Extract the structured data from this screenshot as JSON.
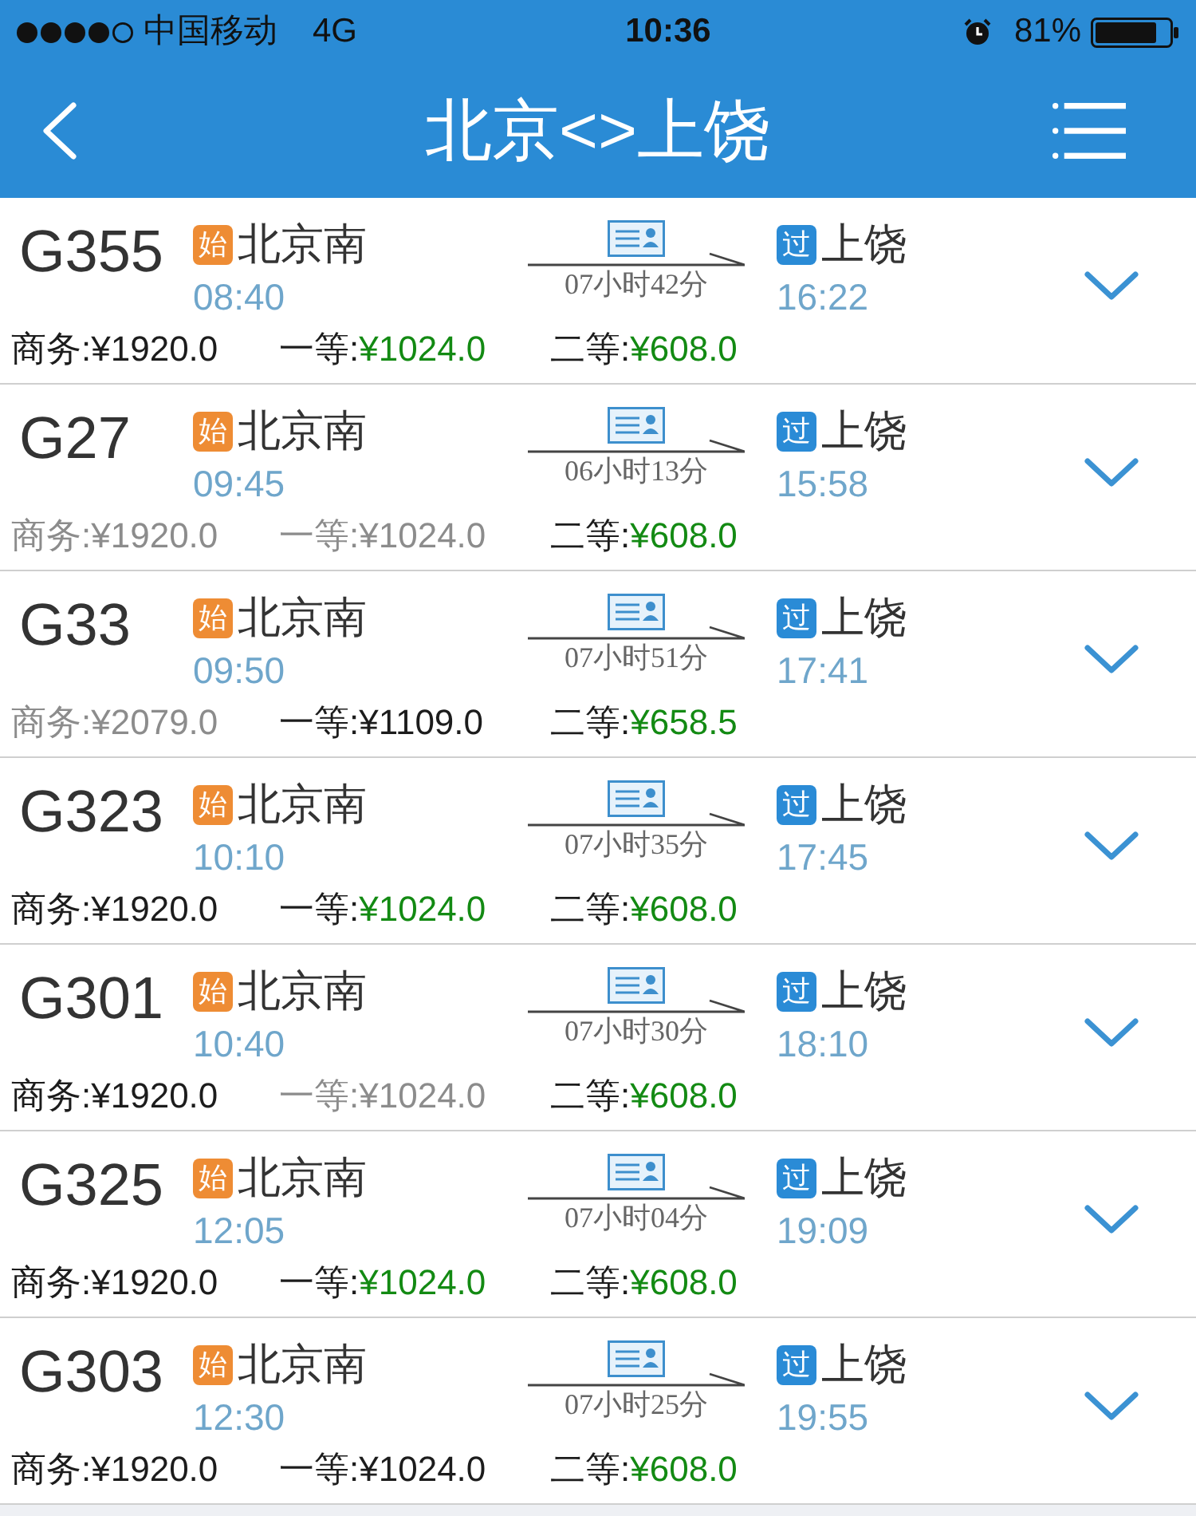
{
  "status_bar": {
    "carrier": "中国移动",
    "network": "4G",
    "time": "10:36",
    "battery": "81%"
  },
  "nav": {
    "title": "北京<>上饶"
  },
  "trains": [
    {
      "number": "G355",
      "departure": {
        "kind": "origin",
        "badge": "始",
        "station": "北京南",
        "time": "08:40"
      },
      "duration": "07小时42分",
      "arrival": {
        "kind": "passing",
        "badge": "过",
        "station": "上饶",
        "time": "16:22"
      },
      "fares": [
        {
          "label": "商务:",
          "price": "¥1920.0",
          "kind": "few"
        },
        {
          "label": "一等:",
          "price": "¥1024.0",
          "kind": "plenty"
        },
        {
          "label": "二等:",
          "price": "¥608.0",
          "kind": "plenty"
        }
      ]
    },
    {
      "number": "G27",
      "departure": {
        "kind": "origin",
        "badge": "始",
        "station": "北京南",
        "time": "09:45"
      },
      "duration": "06小时13分",
      "arrival": {
        "kind": "passing",
        "badge": "过",
        "station": "上饶",
        "time": "15:58"
      },
      "fares": [
        {
          "label": "商务:",
          "price": "¥1920.0",
          "kind": "none"
        },
        {
          "label": "一等:",
          "price": "¥1024.0",
          "kind": "none"
        },
        {
          "label": "二等:",
          "price": "¥608.0",
          "kind": "plenty"
        }
      ]
    },
    {
      "number": "G33",
      "departure": {
        "kind": "origin",
        "badge": "始",
        "station": "北京南",
        "time": "09:50"
      },
      "duration": "07小时51分",
      "arrival": {
        "kind": "passing",
        "badge": "过",
        "station": "上饶",
        "time": "17:41"
      },
      "fares": [
        {
          "label": "商务:",
          "price": "¥2079.0",
          "kind": "none"
        },
        {
          "label": "一等:",
          "price": "¥1109.0",
          "kind": "few"
        },
        {
          "label": "二等:",
          "price": "¥658.5",
          "kind": "plenty"
        }
      ]
    },
    {
      "number": "G323",
      "departure": {
        "kind": "origin",
        "badge": "始",
        "station": "北京南",
        "time": "10:10"
      },
      "duration": "07小时35分",
      "arrival": {
        "kind": "passing",
        "badge": "过",
        "station": "上饶",
        "time": "17:45"
      },
      "fares": [
        {
          "label": "商务:",
          "price": "¥1920.0",
          "kind": "few"
        },
        {
          "label": "一等:",
          "price": "¥1024.0",
          "kind": "plenty"
        },
        {
          "label": "二等:",
          "price": "¥608.0",
          "kind": "plenty"
        }
      ]
    },
    {
      "number": "G301",
      "departure": {
        "kind": "origin",
        "badge": "始",
        "station": "北京南",
        "time": "10:40"
      },
      "duration": "07小时30分",
      "arrival": {
        "kind": "passing",
        "badge": "过",
        "station": "上饶",
        "time": "18:10"
      },
      "fares": [
        {
          "label": "商务:",
          "price": "¥1920.0",
          "kind": "few"
        },
        {
          "label": "一等:",
          "price": "¥1024.0",
          "kind": "none"
        },
        {
          "label": "二等:",
          "price": "¥608.0",
          "kind": "plenty"
        }
      ]
    },
    {
      "number": "G325",
      "departure": {
        "kind": "origin",
        "badge": "始",
        "station": "北京南",
        "time": "12:05"
      },
      "duration": "07小时04分",
      "arrival": {
        "kind": "passing",
        "badge": "过",
        "station": "上饶",
        "time": "19:09"
      },
      "fares": [
        {
          "label": "商务:",
          "price": "¥1920.0",
          "kind": "few"
        },
        {
          "label": "一等:",
          "price": "¥1024.0",
          "kind": "plenty"
        },
        {
          "label": "二等:",
          "price": "¥608.0",
          "kind": "plenty"
        }
      ]
    },
    {
      "number": "G303",
      "departure": {
        "kind": "origin",
        "badge": "始",
        "station": "北京南",
        "time": "12:30"
      },
      "duration": "07小时25分",
      "arrival": {
        "kind": "passing",
        "badge": "过",
        "station": "上饶",
        "time": "19:55"
      },
      "fares": [
        {
          "label": "商务:",
          "price": "¥1920.0",
          "kind": "few"
        },
        {
          "label": "一等:",
          "price": "¥1024.0",
          "kind": "few"
        },
        {
          "label": "二等:",
          "price": "¥608.0",
          "kind": "plenty"
        }
      ]
    }
  ]
}
